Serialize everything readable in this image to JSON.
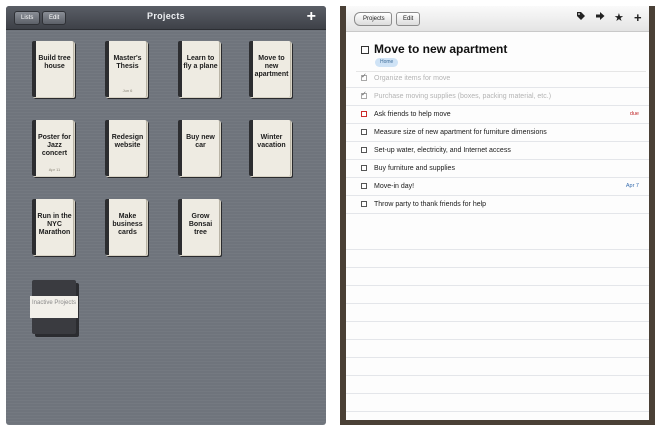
{
  "left": {
    "nav": {
      "lists_label": "Lists",
      "edit_label": "Edit",
      "title": "Projects",
      "add_label": "+"
    },
    "projects": [
      {
        "title": "Build tree house",
        "date": ""
      },
      {
        "title": "Master's Thesis",
        "date": "Jun 6"
      },
      {
        "title": "Learn to fly a plane",
        "date": ""
      },
      {
        "title": "Move to new apartment",
        "date": ""
      },
      {
        "title": "Poster for Jazz concert",
        "date": "Apr 11"
      },
      {
        "title": "Redesign website",
        "date": ""
      },
      {
        "title": "Buy new car",
        "date": ""
      },
      {
        "title": "Winter vacation",
        "date": ""
      },
      {
        "title": "Run in the NYC Marathon",
        "date": ""
      },
      {
        "title": "Make business cards",
        "date": ""
      },
      {
        "title": "Grow Bonsai tree",
        "date": ""
      }
    ],
    "inactive_label": "Inactive Projects"
  },
  "right": {
    "nav": {
      "back_label": "Projects",
      "edit_label": "Edit",
      "tag_icon": "tag-icon",
      "forward_icon": "arrow-right-icon",
      "star_icon": "star-icon",
      "add_label": "+"
    },
    "project_title": "Move to new apartment",
    "project_tag": "Home",
    "tasks": [
      {
        "text": "Organize items for move",
        "done": true,
        "meta": ""
      },
      {
        "text": "Purchase moving supplies (boxes, packing material, etc.)",
        "done": true,
        "meta": ""
      },
      {
        "text": "Ask friends to help move",
        "done": false,
        "meta": "due",
        "meta_color": "#c0282a",
        "box_color": "#cc2a2a"
      },
      {
        "text": "Measure size of new apartment for furniture dimensions",
        "done": false,
        "meta": ""
      },
      {
        "text": "Set-up water, electricity, and Internet access",
        "done": false,
        "meta": ""
      },
      {
        "text": "Buy furniture and supplies",
        "done": false,
        "meta": ""
      },
      {
        "text": "Move-in day!",
        "done": false,
        "meta": "Apr 7",
        "meta_color": "#3a6fb0"
      },
      {
        "text": "Throw party to thank friends for help",
        "done": false,
        "meta": ""
      }
    ]
  }
}
